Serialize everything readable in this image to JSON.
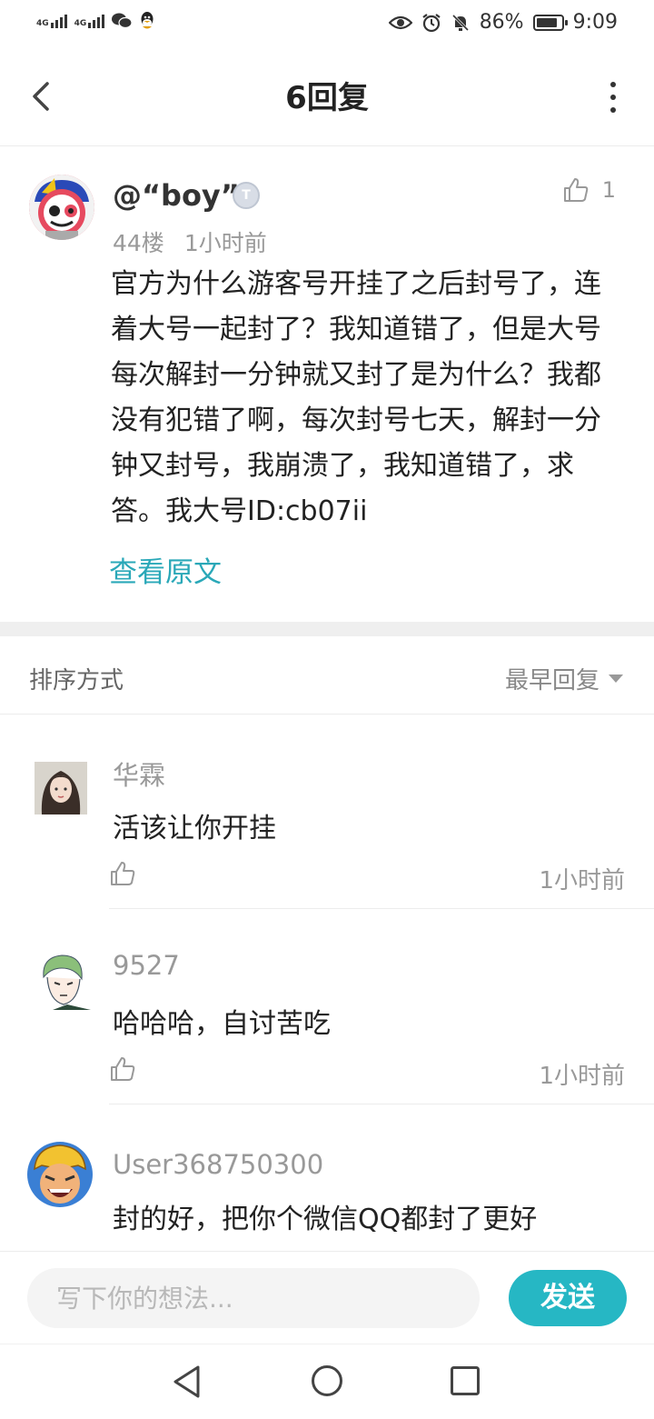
{
  "status_bar": {
    "signal1": "4G",
    "signal2": "4G",
    "battery_pct": "86%",
    "battery_level": 0.86,
    "time": "9:09"
  },
  "header": {
    "title": "6回复"
  },
  "post": {
    "username": "@“boy”",
    "badge": "T",
    "likes": "1",
    "floor": "44楼",
    "time": "1小时前",
    "content": "官方为什么游客号开挂了之后封号了，连着大号一起封了？我知道错了，但是大号每次解封一分钟就又封了是为什么？我都没有犯错了啊，每次封号七天，解封一分钟又封号，我崩溃了，我知道错了，求答。我大号ID:cb07ii",
    "view_original": "查看原文"
  },
  "sort": {
    "label": "排序方式",
    "selected": "最早回复"
  },
  "replies": [
    {
      "name": "华霖",
      "text": "活该让你开挂",
      "time": "1小时前"
    },
    {
      "name": "9527",
      "text": "哈哈哈，自讨苦吃",
      "time": "1小时前"
    },
    {
      "name": "User368750300",
      "text": "封的好，把你个微信QQ都封了更好"
    }
  ],
  "composer": {
    "placeholder": "写下你的想法...",
    "send_label": "发送"
  },
  "colors": {
    "accent": "#26b7c4",
    "link": "#2aa8b8"
  }
}
